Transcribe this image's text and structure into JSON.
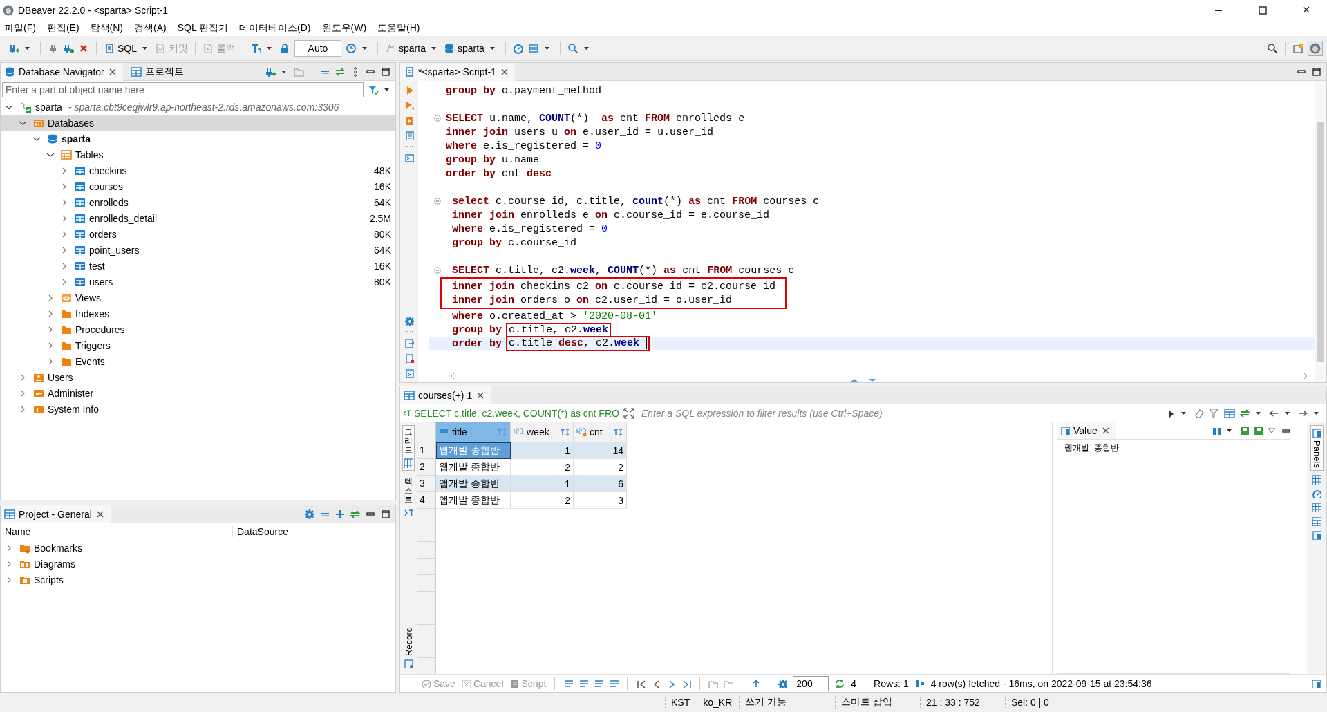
{
  "window": {
    "title": "DBeaver 22.2.0 - <sparta> Script-1"
  },
  "menu": [
    "파일(F)",
    "편집(E)",
    "탐색(N)",
    "검색(A)",
    "SQL 편집기",
    "데이터베이스(D)",
    "윈도우(W)",
    "도움말(H)"
  ],
  "toolbar": {
    "items": [
      {
        "kind": "sql",
        "label": "SQL",
        "disabled": false
      },
      {
        "kind": "commit",
        "label": "커밋",
        "disabled": true
      },
      {
        "kind": "rollback",
        "label": "롤백",
        "disabled": true
      },
      {
        "kind": "mode",
        "label": "Auto",
        "disabled": false
      },
      {
        "kind": "datasource",
        "label": "sparta",
        "disabled": false
      },
      {
        "kind": "schema",
        "label": "sparta",
        "disabled": false
      }
    ]
  },
  "navigator": {
    "tabs": [
      {
        "label": "Database Navigator",
        "selected": true,
        "closable": true
      },
      {
        "label": "프로젝트",
        "selected": false,
        "closable": false
      }
    ],
    "filter": {
      "placeholder": "Enter a part of object name here"
    },
    "tree": [
      {
        "label": "sparta",
        "kind": "connection",
        "detail": "- sparta.cbt9ceqjwlr9.ap-northeast-2.rds.amazonaws.com:3306",
        "expanded": true,
        "selected": false,
        "children": [
          {
            "label": "Databases",
            "kind": "databases",
            "expanded": true,
            "selected": true,
            "children": [
              {
                "label": "sparta",
                "kind": "database",
                "expanded": true,
                "selected": false,
                "children": [
                  {
                    "label": "Tables",
                    "kind": "tables",
                    "expanded": true,
                    "selected": false,
                    "children": [
                      {
                        "label": "checkins",
                        "kind": "table",
                        "size": "48K",
                        "expanded": false,
                        "selected": false
                      },
                      {
                        "label": "courses",
                        "kind": "table",
                        "size": "16K",
                        "expanded": false,
                        "selected": false
                      },
                      {
                        "label": "enrolleds",
                        "kind": "table",
                        "size": "64K",
                        "expanded": false,
                        "selected": false
                      },
                      {
                        "label": "enrolleds_detail",
                        "kind": "table",
                        "size": "2.5M",
                        "expanded": false,
                        "selected": false
                      },
                      {
                        "label": "orders",
                        "kind": "table",
                        "size": "80K",
                        "expanded": false,
                        "selected": false
                      },
                      {
                        "label": "point_users",
                        "kind": "table",
                        "size": "64K",
                        "expanded": false,
                        "selected": false
                      },
                      {
                        "label": "test",
                        "kind": "table",
                        "size": "16K",
                        "expanded": false,
                        "selected": false
                      },
                      {
                        "label": "users",
                        "kind": "table",
                        "size": "80K",
                        "expanded": false,
                        "selected": false
                      }
                    ]
                  },
                  {
                    "label": "Views",
                    "kind": "views",
                    "expanded": false,
                    "selected": false
                  },
                  {
                    "label": "Indexes",
                    "kind": "folder",
                    "expanded": false,
                    "selected": false
                  },
                  {
                    "label": "Procedures",
                    "kind": "folder",
                    "expanded": false,
                    "selected": false
                  },
                  {
                    "label": "Triggers",
                    "kind": "folder",
                    "expanded": false,
                    "selected": false
                  },
                  {
                    "label": "Events",
                    "kind": "folder",
                    "expanded": false,
                    "selected": false
                  }
                ]
              }
            ]
          },
          {
            "label": "Users",
            "kind": "users",
            "expanded": false,
            "selected": false
          },
          {
            "label": "Administer",
            "kind": "admin",
            "expanded": false,
            "selected": false
          },
          {
            "label": "System Info",
            "kind": "info",
            "expanded": false,
            "selected": false
          }
        ]
      }
    ]
  },
  "project": {
    "tab": {
      "label": "Project - General"
    },
    "columns": [
      "Name",
      "DataSource"
    ],
    "items": [
      {
        "label": "Bookmarks",
        "kind": "bookmarks",
        "expanded": false
      },
      {
        "label": "Diagrams",
        "kind": "diagrams",
        "expanded": false
      },
      {
        "label": "Scripts",
        "kind": "scripts",
        "expanded": false
      }
    ]
  },
  "editor": {
    "tab": {
      "label": "*<sparta> Script-1"
    },
    "lines": [
      {
        "kind": "code",
        "fold": false,
        "current": false,
        "tokens": [
          {
            "kind": "kw",
            "text": "group by"
          },
          {
            "kind": "plain",
            "text": " o.payment_method"
          }
        ]
      },
      {
        "kind": "blank"
      },
      {
        "kind": "code",
        "fold": true,
        "current": false,
        "tokens": [
          {
            "kind": "kw",
            "text": "SELECT"
          },
          {
            "kind": "plain",
            "text": " u.name, "
          },
          {
            "kind": "fn",
            "text": "COUNT"
          },
          {
            "kind": "plain",
            "text": "(*)  "
          },
          {
            "kind": "kw",
            "text": "as"
          },
          {
            "kind": "plain",
            "text": " cnt "
          },
          {
            "kind": "kw",
            "text": "FROM"
          },
          {
            "kind": "plain",
            "text": " enrolleds e"
          }
        ]
      },
      {
        "kind": "code",
        "fold": false,
        "current": false,
        "tokens": [
          {
            "kind": "kw",
            "text": "inner join"
          },
          {
            "kind": "plain",
            "text": " users u "
          },
          {
            "kind": "kw",
            "text": "on"
          },
          {
            "kind": "plain",
            "text": " e.user_id = u.user_id"
          }
        ]
      },
      {
        "kind": "code",
        "fold": false,
        "current": false,
        "tokens": [
          {
            "kind": "kw",
            "text": "where"
          },
          {
            "kind": "plain",
            "text": " e.is_registered = "
          },
          {
            "kind": "num",
            "text": "0"
          }
        ]
      },
      {
        "kind": "code",
        "fold": false,
        "current": false,
        "tokens": [
          {
            "kind": "kw",
            "text": "group by"
          },
          {
            "kind": "plain",
            "text": " u.name"
          }
        ]
      },
      {
        "kind": "code",
        "fold": false,
        "current": false,
        "tokens": [
          {
            "kind": "kw",
            "text": "order by"
          },
          {
            "kind": "plain",
            "text": " cnt "
          },
          {
            "kind": "kw",
            "text": "desc"
          }
        ]
      },
      {
        "kind": "blank"
      },
      {
        "kind": "code",
        "fold": true,
        "current": false,
        "tokens": [
          {
            "kind": "kw",
            "text": " select"
          },
          {
            "kind": "plain",
            "text": " c.course_id, c.title, "
          },
          {
            "kind": "fn",
            "text": "count"
          },
          {
            "kind": "plain",
            "text": "(*) "
          },
          {
            "kind": "kw",
            "text": "as"
          },
          {
            "kind": "plain",
            "text": " cnt "
          },
          {
            "kind": "kw",
            "text": "FROM"
          },
          {
            "kind": "plain",
            "text": " courses c"
          }
        ]
      },
      {
        "kind": "code",
        "fold": false,
        "current": false,
        "tokens": [
          {
            "kind": "kw",
            "text": " inner join"
          },
          {
            "kind": "plain",
            "text": " enrolleds e "
          },
          {
            "kind": "kw",
            "text": "on"
          },
          {
            "kind": "plain",
            "text": " c.course_id = e.course_id"
          }
        ]
      },
      {
        "kind": "code",
        "fold": false,
        "current": false,
        "tokens": [
          {
            "kind": "kw",
            "text": " where"
          },
          {
            "kind": "plain",
            "text": " e.is_registered = "
          },
          {
            "kind": "num",
            "text": "0"
          }
        ]
      },
      {
        "kind": "code",
        "fold": false,
        "current": false,
        "tokens": [
          {
            "kind": "kw",
            "text": " group by"
          },
          {
            "kind": "plain",
            "text": " c.course_id"
          }
        ]
      },
      {
        "kind": "blank"
      },
      {
        "kind": "code",
        "fold": true,
        "current": false,
        "tokens": [
          {
            "kind": "kw",
            "text": " SELECT"
          },
          {
            "kind": "plain",
            "text": " c.title, c2."
          },
          {
            "kind": "fn",
            "text": "week"
          },
          {
            "kind": "plain",
            "text": ", "
          },
          {
            "kind": "fn",
            "text": "COUNT"
          },
          {
            "kind": "plain",
            "text": "(*) "
          },
          {
            "kind": "kw",
            "text": "as"
          },
          {
            "kind": "plain",
            "text": " cnt "
          },
          {
            "kind": "kw",
            "text": "FROM"
          },
          {
            "kind": "plain",
            "text": " courses c"
          }
        ]
      },
      {
        "kind": "box",
        "lines": [
          {
            "kind": "code",
            "fold": false,
            "current": false,
            "tokens": [
              {
                "kind": "kw",
                "text": " inner join"
              },
              {
                "kind": "plain",
                "text": " checkins c2 "
              },
              {
                "kind": "kw",
                "text": "on"
              },
              {
                "kind": "plain",
                "text": " c.course_id = c2.course_id"
              }
            ]
          },
          {
            "kind": "code",
            "fold": false,
            "current": false,
            "tokens": [
              {
                "kind": "kw",
                "text": " inner join"
              },
              {
                "kind": "plain",
                "text": " orders o "
              },
              {
                "kind": "kw",
                "text": "on"
              },
              {
                "kind": "plain",
                "text": " c2.user_id = o.user_id"
              }
            ]
          }
        ]
      },
      {
        "kind": "code",
        "fold": false,
        "current": false,
        "tokens": [
          {
            "kind": "kw",
            "text": " where"
          },
          {
            "kind": "plain",
            "text": " o.created_at > "
          },
          {
            "kind": "str",
            "text": "'2020-08-01'"
          }
        ]
      },
      {
        "kind": "code",
        "fold": false,
        "current": false,
        "tokens": [
          {
            "kind": "kw",
            "text": " group by"
          },
          {
            "kind": "plain",
            "text": "c.title, c2.",
            "boxed": true
          },
          {
            "kind": "fn",
            "text": "week",
            "boxed": true
          }
        ]
      },
      {
        "kind": "code",
        "fold": false,
        "current": true,
        "tokens": [
          {
            "kind": "kw",
            "text": " order by"
          },
          {
            "kind": "plain",
            "text": "c.title ",
            "boxed": true
          },
          {
            "kind": "kw",
            "text": "desc",
            "boxed": true
          },
          {
            "kind": "plain",
            "text": ", c2.",
            "boxed": true
          },
          {
            "kind": "fn",
            "text": "week",
            "boxed": true
          }
        ]
      }
    ]
  },
  "results": {
    "tab": {
      "label": "courses(+) 1"
    },
    "query": "SELECT c.title, c2.week, COUNT(*) as cnt FRO",
    "filter": {
      "placeholder": "Enter a SQL expression to filter results (use Ctrl+Space)"
    },
    "view_tabs": [
      {
        "label": "그리드",
        "selected": true
      },
      {
        "label": "텍스트",
        "selected": false
      }
    ],
    "record": {
      "label": "Record"
    },
    "columns": [
      {
        "label": "title",
        "kind": "text"
      },
      {
        "label": "week",
        "kind": "number"
      },
      {
        "label": "cnt",
        "kind": "computed"
      }
    ],
    "rows": [
      {
        "number": "1",
        "selected": true,
        "cells": [
          "웹개발 종합반",
          "1",
          "14"
        ]
      },
      {
        "number": "2",
        "selected": false,
        "cells": [
          "웹개발 종합반",
          "2",
          "2"
        ]
      },
      {
        "number": "3",
        "selected": false,
        "cells": [
          "앱개발 종합반",
          "1",
          "6"
        ]
      },
      {
        "number": "4",
        "selected": false,
        "cells": [
          "앱개발 종합반",
          "2",
          "3"
        ]
      }
    ],
    "value_panel": {
      "title": "Value",
      "text": "웹개발  종합반"
    },
    "side_tab": {
      "label": "Panels"
    },
    "bottom": {
      "actions": [
        {
          "label": "Save",
          "disabled": true
        },
        {
          "label": "Cancel",
          "disabled": true
        },
        {
          "label": "Script",
          "disabled": true
        }
      ],
      "limit": "200",
      "refresh_count": "4",
      "rows_label": "Rows: 1",
      "message": "4 row(s) fetched - 16ms, on 2022-09-15 at 23:54:36"
    }
  },
  "status_bar": [
    "KST",
    "ko_KR",
    "쓰기 가능",
    "스마트 삽입",
    "21 : 33 : 752",
    "Sel: 0 | 0"
  ]
}
